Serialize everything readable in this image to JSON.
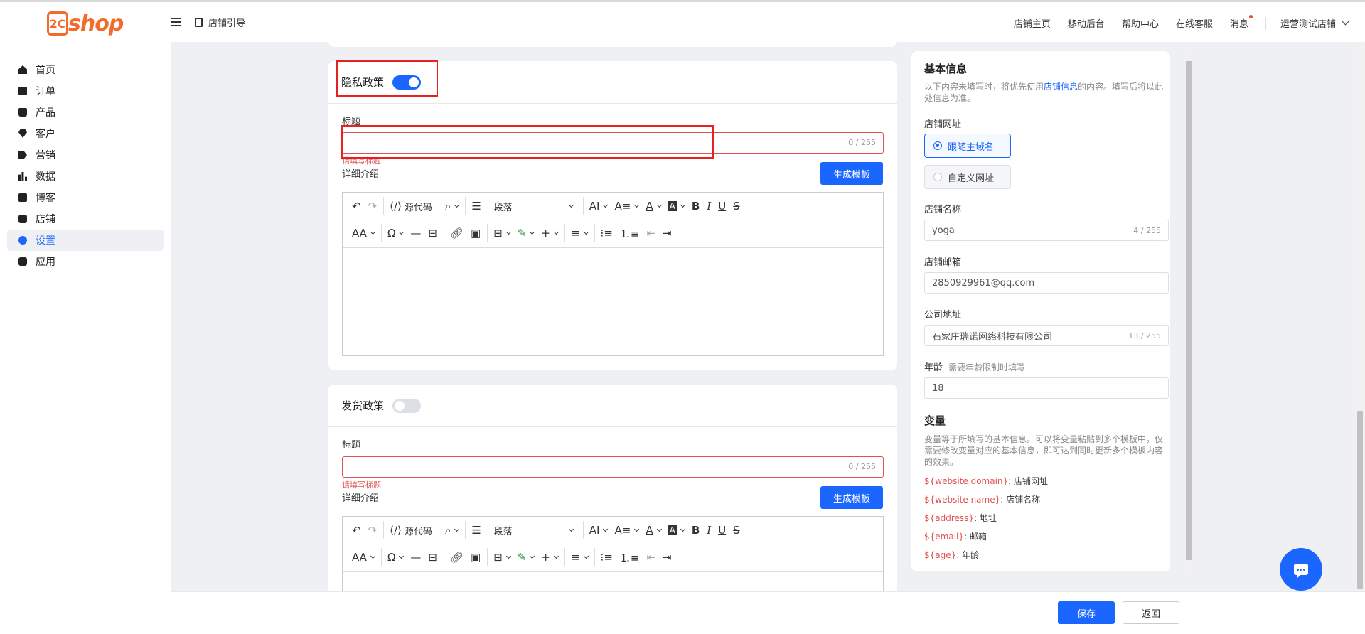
{
  "header": {
    "logo_mark": "2C",
    "logo_text": "shop",
    "guide": "店铺引导",
    "nav": [
      "店铺主页",
      "移动后台",
      "帮助中心",
      "在线客服",
      "消息"
    ],
    "store": "运营测试店铺"
  },
  "sidebar": {
    "items": [
      {
        "label": "首页",
        "icon": "home-icon"
      },
      {
        "label": "订单",
        "icon": "order-icon"
      },
      {
        "label": "产品",
        "icon": "bag-icon"
      },
      {
        "label": "客户",
        "icon": "gem-icon"
      },
      {
        "label": "营销",
        "icon": "tag-icon"
      },
      {
        "label": "数据",
        "icon": "chart-icon"
      },
      {
        "label": "博客",
        "icon": "edit-icon"
      },
      {
        "label": "店铺",
        "icon": "store-icon"
      },
      {
        "label": "设置",
        "icon": "gear-icon"
      },
      {
        "label": "应用",
        "icon": "puzzle-icon"
      }
    ],
    "active_index": 8
  },
  "privacy": {
    "title": "隐私政策",
    "enabled": true,
    "title_label": "标题",
    "title_count": "0 / 255",
    "error": "请填写标题",
    "detail_label": "详细介绍",
    "generate": "生成模板"
  },
  "shipping": {
    "title": "发货政策",
    "enabled": false,
    "title_label": "标题",
    "title_count": "0 / 255",
    "error": "请填写标题",
    "detail_label": "详细介绍",
    "generate": "生成模板"
  },
  "editor": {
    "source_code": "源代码",
    "paragraph": "段落"
  },
  "basic_info": {
    "title": "基本信息",
    "desc_before": "以下内容未填写时，将优先使用",
    "desc_link": "店铺信息",
    "desc_after": "的内容。填写后将以此处信息为准。",
    "url_label": "店铺网址",
    "url_opt1": "跟随主域名",
    "url_opt2": "自定义网址",
    "name_label": "店铺名称",
    "name_value": "yoga",
    "name_count": "4 / 255",
    "email_label": "店铺邮箱",
    "email_value": "2850929961@qq.com",
    "address_label": "公司地址",
    "address_value": "石家庄瑞诺网络科技有限公司",
    "address_count": "13 / 255",
    "age_label": "年龄",
    "age_hint": "需要年龄限制时填写",
    "age_value": "18"
  },
  "variables": {
    "title": "变量",
    "desc": "变量等于所填写的基本信息。可以将变量粘贴到多个模板中，仅需要修改变量对应的基本信息，即可达到同时更新多个模板内容的效果。",
    "items": [
      {
        "key": "${website domain}",
        "value": ": 店铺网址"
      },
      {
        "key": "${website name}",
        "value": ": 店铺名称"
      },
      {
        "key": "${address}",
        "value": ": 地址"
      },
      {
        "key": "${email}",
        "value": ": 邮箱"
      },
      {
        "key": "${age}",
        "value": ": 年龄"
      }
    ]
  },
  "footer": {
    "save": "保存",
    "back": "返回"
  },
  "colors": {
    "primary": "#1a66ff",
    "brand": "#f26b2a",
    "error": "#e05252",
    "highlight": "#e52222"
  }
}
